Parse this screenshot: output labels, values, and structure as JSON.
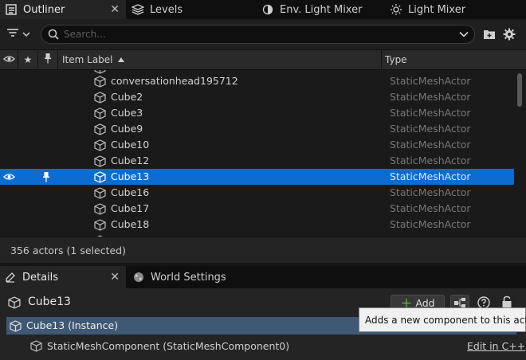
{
  "tabs_top": [
    {
      "label": "Outliner",
      "icon": "outliner-icon",
      "active": true
    },
    {
      "label": "Levels",
      "icon": "levels-icon"
    },
    {
      "label": "Env. Light Mixer",
      "icon": "env-light-mixer-icon"
    },
    {
      "label": "Light Mixer",
      "icon": "light-mixer-icon"
    }
  ],
  "toolbar": {
    "search_placeholder": "Search..."
  },
  "columns": {
    "item_label": "Item Label",
    "type": "Type"
  },
  "rows": [
    {
      "label": "conversationhead195712",
      "type": "StaticMeshActor",
      "selected": false
    },
    {
      "label": "Cube2",
      "type": "StaticMeshActor",
      "selected": false
    },
    {
      "label": "Cube3",
      "type": "StaticMeshActor",
      "selected": false
    },
    {
      "label": "Cube9",
      "type": "StaticMeshActor",
      "selected": false
    },
    {
      "label": "Cube10",
      "type": "StaticMeshActor",
      "selected": false
    },
    {
      "label": "Cube12",
      "type": "StaticMeshActor",
      "selected": false
    },
    {
      "label": "Cube13",
      "type": "StaticMeshActor",
      "selected": true
    },
    {
      "label": "Cube16",
      "type": "StaticMeshActor",
      "selected": false
    },
    {
      "label": "Cube17",
      "type": "StaticMeshActor",
      "selected": false
    },
    {
      "label": "Cube18",
      "type": "StaticMeshActor",
      "selected": false
    }
  ],
  "status": {
    "text": "356 actors (1 selected)"
  },
  "tabs_bottom": [
    {
      "label": "Details",
      "icon": "details-icon",
      "active": true
    },
    {
      "label": "World Settings",
      "icon": "world-settings-icon"
    }
  ],
  "details": {
    "actor_name": "Cube13",
    "add_label": "Add",
    "instance_label": "Cube13 (Instance)",
    "component_label": "StaticMeshComponent (StaticMeshComponent0)",
    "edit_link": "Edit in C++",
    "tooltip": "Adds a new component to this actor"
  }
}
